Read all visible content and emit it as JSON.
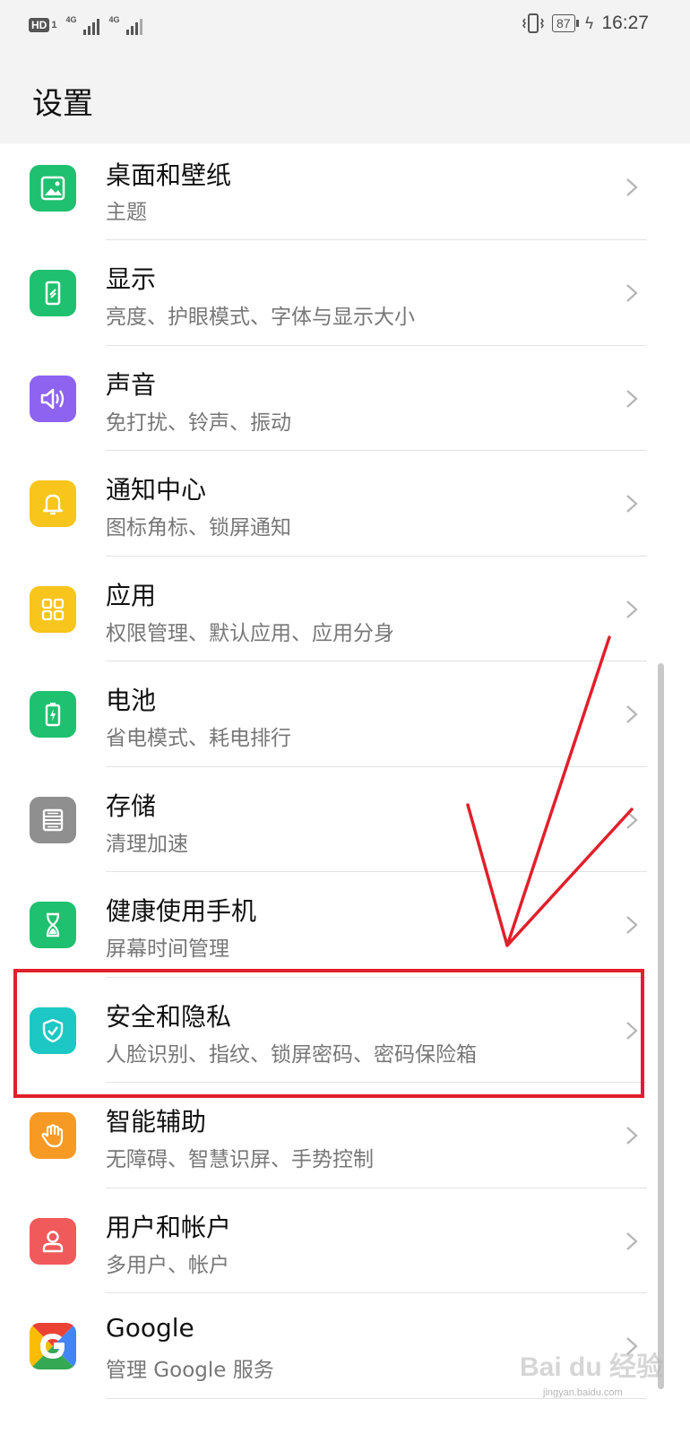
{
  "status_bar": {
    "hd_label": "HD",
    "sim_number": "1",
    "network1": "4G",
    "network2": "4G",
    "battery": "87",
    "time": "16:27",
    "icons": [
      "hd-icon",
      "signal-icon",
      "vibrate-icon",
      "battery-icon",
      "charging-icon"
    ]
  },
  "page_title": "设置",
  "settings": [
    {
      "title": "桌面和壁纸",
      "subtitle": "主题",
      "icon": "wallpaper-icon",
      "color": "#1fc06f"
    },
    {
      "title": "显示",
      "subtitle": "亮度、护眼模式、字体与显示大小",
      "icon": "display-icon",
      "color": "#1fc06f"
    },
    {
      "title": "声音",
      "subtitle": "免打扰、铃声、振动",
      "icon": "speaker-icon",
      "color": "#8d63f0"
    },
    {
      "title": "通知中心",
      "subtitle": "图标角标、锁屏通知",
      "icon": "bell-icon",
      "color": "#f7c51b"
    },
    {
      "title": "应用",
      "subtitle": "权限管理、默认应用、应用分身",
      "icon": "apps-grid-icon",
      "color": "#f7c51b"
    },
    {
      "title": "电池",
      "subtitle": "省电模式、耗电排行",
      "icon": "battery-icon",
      "color": "#1fc06f"
    },
    {
      "title": "存储",
      "subtitle": "清理加速",
      "icon": "storage-icon",
      "color": "#8f8f8f"
    },
    {
      "title": "健康使用手机",
      "subtitle": "屏幕时间管理",
      "icon": "hourglass-icon",
      "color": "#1fc06f"
    },
    {
      "title": "安全和隐私",
      "subtitle": "人脸识别、指纹、锁屏密码、密码保险箱",
      "icon": "shield-icon",
      "color": "#1cc7c4"
    },
    {
      "title": "智能辅助",
      "subtitle": "无障碍、智慧识屏、手势控制",
      "icon": "hand-icon",
      "color": "#f79a24"
    },
    {
      "title": "用户和帐户",
      "subtitle": "多用户、帐户",
      "icon": "user-icon",
      "color": "#f05a5a"
    },
    {
      "title": "Google",
      "subtitle": "管理 Google 服务",
      "icon": "google-icon",
      "color": "#ffffff"
    }
  ],
  "annotation_color": "#e0202a",
  "watermark": "Bai du 经验",
  "watermark_url": "jingyan.baidu.com"
}
